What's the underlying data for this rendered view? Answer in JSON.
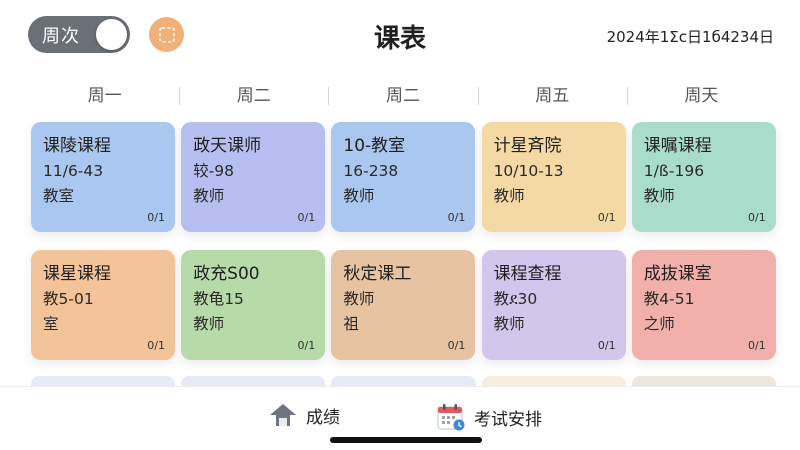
{
  "header": {
    "toggle_label": "周次",
    "title": "课表",
    "date": "2024年1Σc日1б4234日"
  },
  "days": [
    "周一",
    "周二",
    "周二",
    "周五",
    "周天"
  ],
  "colors": {
    "toggle_bg": "#6b6f76",
    "grid_button": "#f0b07a"
  },
  "cards": [
    {
      "l1": "课陵课程",
      "l2": "11/6-43",
      "l3": "教室",
      "count": "0/1",
      "color": "#a9c7ef"
    },
    {
      "l1": "政天课师",
      "l2": "较-98",
      "l3": "教师",
      "count": "0/1",
      "color": "#b7bff0"
    },
    {
      "l1": "10-教室",
      "l2": "16-238",
      "l3": "教师",
      "count": "0/1",
      "color": "#a9c7ef"
    },
    {
      "l1": "计星斉院",
      "l2": "10/10-13",
      "l3": "教师",
      "count": "0/1",
      "color": "#f5d9a4"
    },
    {
      "l1": "课嘱课程",
      "l2": "1/ß-196",
      "l3": "教师",
      "count": "0/1",
      "color": "#a9dccb"
    },
    {
      "l1": "课星课程",
      "l2": "教5-01",
      "l3": "室",
      "count": "0/1",
      "color": "#f3c39a"
    },
    {
      "l1": "政充S00",
      "l2": "教龟15",
      "l3": "教师",
      "count": "0/1",
      "color": "#b7dba8"
    },
    {
      "l1": "秋定课工",
      "l2": "教师",
      "l3": "祖",
      "count": "0/1",
      "color": "#e8c3a2"
    },
    {
      "l1": "课程查程",
      "l2": "教ደ30",
      "l3": "教师",
      "count": "0/1",
      "color": "#d2c6ec"
    },
    {
      "l1": "成抜课室",
      "l2": "教4-51",
      "l3": "之师",
      "count": "0/1",
      "color": "#f1b0aa"
    }
  ],
  "ghost_colors": [
    "#e6ecf7",
    "#e8eaf5",
    "#e6ecf7",
    "#f7eedd",
    "#ece6df"
  ],
  "bottom_tabs": {
    "grades": {
      "label": "成绩",
      "icon": "upload-icon"
    },
    "exam": {
      "label": "考试安排",
      "icon": "calendar-icon"
    }
  }
}
